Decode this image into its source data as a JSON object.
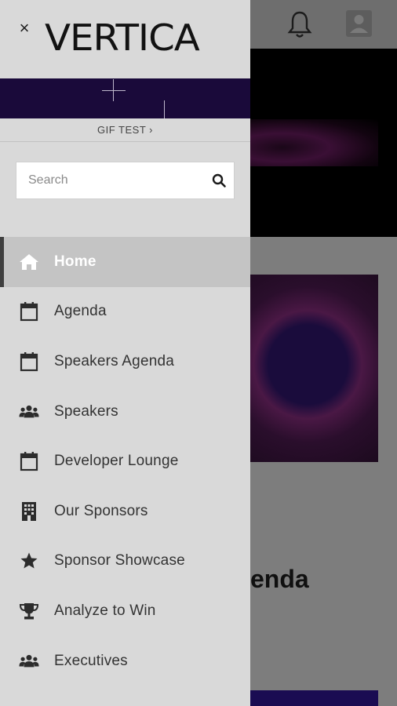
{
  "drawer": {
    "close_label": "×",
    "logo_text": "VERTICA",
    "banner_link": "GIF TEST ›",
    "search": {
      "placeholder": "Search",
      "value": ""
    },
    "menu": [
      {
        "label": "Home",
        "icon": "home-icon",
        "active": true
      },
      {
        "label": "Agenda",
        "icon": "calendar-icon",
        "active": false
      },
      {
        "label": "Speakers Agenda",
        "icon": "calendar-icon",
        "active": false
      },
      {
        "label": "Speakers",
        "icon": "people-icon",
        "active": false
      },
      {
        "label": "Developer Lounge",
        "icon": "calendar-icon",
        "active": false
      },
      {
        "label": "Our Sponsors",
        "icon": "building-icon",
        "active": false
      },
      {
        "label": "Sponsor Showcase",
        "icon": "star-icon",
        "active": false
      },
      {
        "label": "Analyze to Win",
        "icon": "trophy-icon",
        "active": false
      },
      {
        "label": "Executives",
        "icon": "people-icon",
        "active": false
      }
    ]
  },
  "background": {
    "heading_fragment": "enda"
  },
  "colors": {
    "drawer_bg": "#d9d9d9",
    "active_bg": "#c4c4c4",
    "banner_bg": "#1a0a3a",
    "overlay": "#7d7d7d"
  }
}
